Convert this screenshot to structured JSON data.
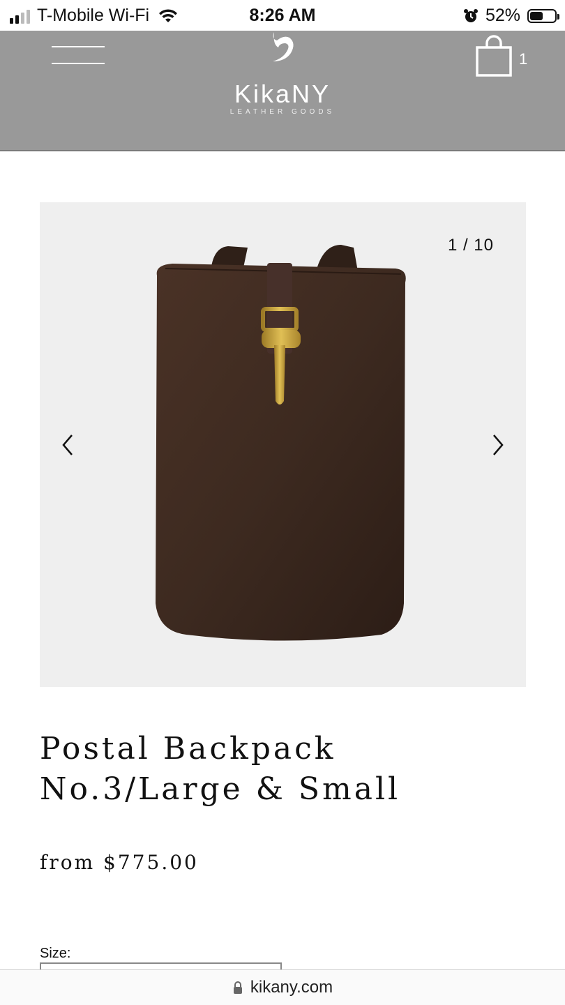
{
  "status_bar": {
    "carrier": "T-Mobile Wi-Fi",
    "time": "8:26 AM",
    "battery_percent": "52%",
    "battery_level": 0.52,
    "signal_bars": 2
  },
  "header": {
    "menu_icon": "hamburger-icon",
    "logo_name": "KikaNY",
    "logo_tagline": "LEATHER GOODS",
    "cart_icon": "shopping-bag-icon",
    "cart_count": "1",
    "background_color": "#999999"
  },
  "gallery": {
    "counter": "1 / 10",
    "prev_icon": "chevron-left-icon",
    "next_icon": "chevron-right-icon",
    "image": "brown leather backpack with brass clasp"
  },
  "product": {
    "title_line1": "Postal Backpack",
    "title_line2": "No.3/Large & Small",
    "price": "from $775.00",
    "size_label": "Size:"
  },
  "browser": {
    "lock_icon": "lock-icon",
    "url": "kikany.com"
  }
}
